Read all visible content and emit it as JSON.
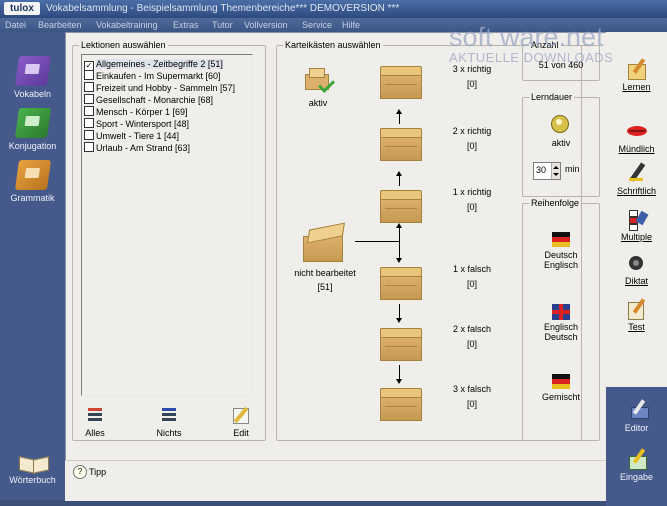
{
  "window": {
    "logo": "tulox",
    "title": "Vokabelsammlung - Beispielsammlung Themenbereiche*** DEMOVERSION ***"
  },
  "menu": [
    "Datei",
    "Bearbeiten",
    "Vokabeltraining",
    "Extras",
    "Tutor",
    "Vollversion",
    "Service",
    "Hilfe"
  ],
  "left_nav": [
    {
      "label": "Vokabeln"
    },
    {
      "label": "Konjugation"
    },
    {
      "label": "Grammatik"
    },
    {
      "label": "Wörterbuch"
    }
  ],
  "lessons": {
    "title": "Lektionen auswählen",
    "items": [
      {
        "label": "Allgemeines - Zeitbegriffe 2 [51]",
        "checked": true
      },
      {
        "label": "Einkaufen - Im Supermarkt [60]",
        "checked": false
      },
      {
        "label": "Freizeit und Hobby - Sammeln [57]",
        "checked": false
      },
      {
        "label": "Gesellschaft - Monarchie [68]",
        "checked": false
      },
      {
        "label": "Mensch - Körper 1 [69]",
        "checked": false
      },
      {
        "label": "Sport - Wintersport [48]",
        "checked": false
      },
      {
        "label": "Umwelt - Tiere 1 [44]",
        "checked": false
      },
      {
        "label": "Urlaub - Am Strand [63]",
        "checked": false
      }
    ],
    "tools": [
      {
        "label": "Alles",
        "icon": "select-all-icon"
      },
      {
        "label": "Nichts",
        "icon": "select-none-icon"
      },
      {
        "label": "Edit",
        "icon": "pencil-icon"
      }
    ]
  },
  "cardboxes": {
    "title": "Karteikästen auswählen",
    "active_label": "aktiv",
    "unprocessed": {
      "label": "nicht bearbeitet",
      "count": "[51]"
    },
    "boxes": [
      {
        "label": "3 x richtig",
        "count": "[0]"
      },
      {
        "label": "2 x richtig",
        "count": "[0]"
      },
      {
        "label": "1 x richtig",
        "count": "[0]"
      },
      {
        "label": "1 x falsch",
        "count": "[0]"
      },
      {
        "label": "2 x falsch",
        "count": "[0]"
      },
      {
        "label": "3 x falsch",
        "count": "[0]"
      }
    ]
  },
  "summary": {
    "title": "Anzahl",
    "value": "51 von 460"
  },
  "duration": {
    "title": "Lerndauer",
    "active_label": "aktiv",
    "value": "30",
    "unit": "min"
  },
  "order": {
    "title": "Reihenfolge",
    "options": [
      {
        "label1": "Deutsch",
        "label2": "Englisch"
      },
      {
        "label1": "Englisch",
        "label2": "Deutsch"
      },
      {
        "label1": "Gemischt",
        "label2": ""
      }
    ]
  },
  "right_nav": [
    {
      "label": "Lernen"
    },
    {
      "label": "Mündlich"
    },
    {
      "label": "Schriftlich"
    },
    {
      "label": "Multiple"
    },
    {
      "label": "Diktat"
    },
    {
      "label": "Test"
    },
    {
      "label": "Editor"
    },
    {
      "label": "Eingabe"
    }
  ],
  "status": {
    "tip": "Tipp"
  },
  "watermark": {
    "line1": "soft ware.net",
    "line2": "AKTUELLE DOWNLOADS"
  },
  "colors": {
    "accent": "#45598a",
    "panel": "#f0eeea",
    "box": "#dcb06a",
    "check": "#3ea63a"
  }
}
